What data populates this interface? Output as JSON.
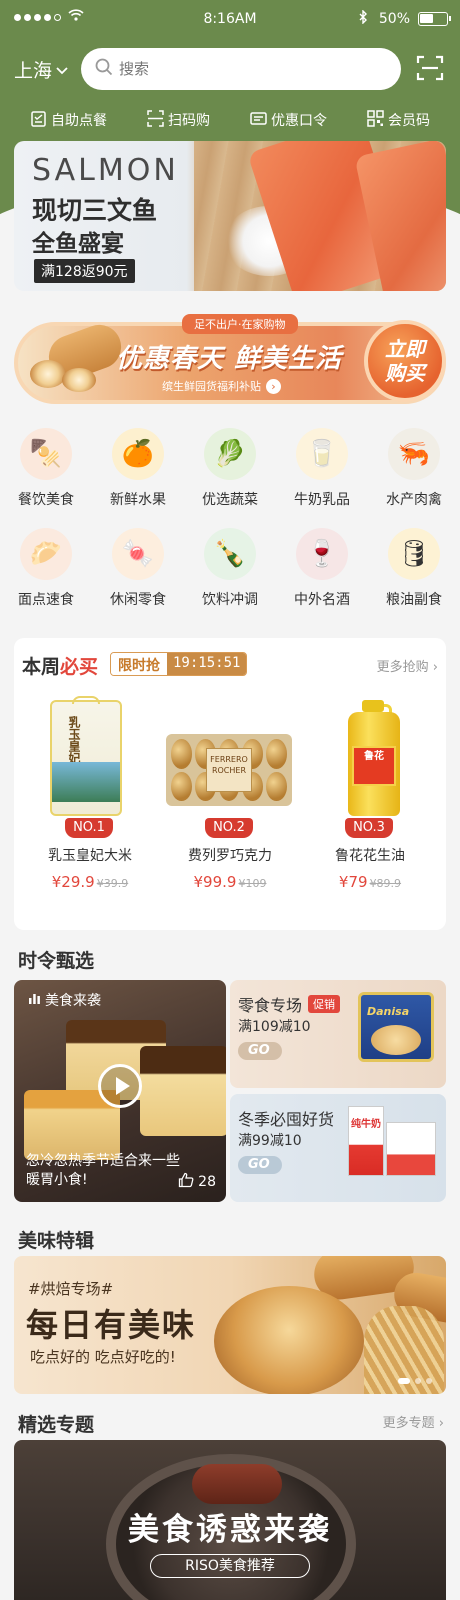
{
  "status_bar": {
    "time": "8:16AM",
    "battery": "50%",
    "battery_level": 0.5
  },
  "header": {
    "city": "上海",
    "search_placeholder": "搜索",
    "quick_nav": [
      {
        "label": "自助点餐",
        "icon": "clipboard-icon"
      },
      {
        "label": "扫码购",
        "icon": "barcode-scan-icon"
      },
      {
        "label": "优惠口令",
        "icon": "coupon-icon"
      },
      {
        "label": "会员码",
        "icon": "qr-code-icon"
      }
    ]
  },
  "banner": {
    "title_en": "SALMON",
    "title_cn": "现切三文鱼",
    "subtitle": "全鱼盛宴",
    "tag": "满128返90元"
  },
  "promo": {
    "ribbon": "足不出户·在家购物",
    "title": "优惠春天 鲜美生活",
    "subtitle": "缤生鲜园货福利补贴",
    "buy_line1": "立即",
    "buy_line2": "购买"
  },
  "categories": [
    {
      "label": "餐饮美食",
      "icon": "food-icon",
      "color": "#fbe8dc",
      "glyph": "🍢"
    },
    {
      "label": "新鲜水果",
      "icon": "fruit-icon",
      "color": "#fdf0cf",
      "glyph": "🍊"
    },
    {
      "label": "优选蔬菜",
      "icon": "vegetable-icon",
      "color": "#e6f2dd",
      "glyph": "🥬"
    },
    {
      "label": "牛奶乳品",
      "icon": "milk-icon",
      "color": "#fdf3dc",
      "glyph": "🥛"
    },
    {
      "label": "水产肉禽",
      "icon": "seafood-icon",
      "color": "#f1eee6",
      "glyph": "🦐"
    },
    {
      "label": "面点速食",
      "icon": "bun-icon",
      "color": "#fbeadf",
      "glyph": "🥟"
    },
    {
      "label": "休闲零食",
      "icon": "snack-icon",
      "color": "#fdeede",
      "glyph": "🍬"
    },
    {
      "label": "饮料冲调",
      "icon": "drink-icon",
      "color": "#e6f3e6",
      "glyph": "🍾"
    },
    {
      "label": "中外名酒",
      "icon": "wine-icon",
      "color": "#f6e6e6",
      "glyph": "🍷"
    },
    {
      "label": "粮油副食",
      "icon": "oil-icon",
      "color": "#fdf2d4",
      "glyph": "🛢"
    }
  ],
  "must_buy": {
    "title_part1": "本周",
    "title_part2": "必买",
    "flash_label": "限时抢",
    "countdown": "19:15:51",
    "more": "更多抢购",
    "products": [
      {
        "rank": "NO.1",
        "name": "乳玉皇妃大米",
        "price": "¥29.9",
        "old_price": "¥39.9",
        "bag_text": "乳玉皇妃"
      },
      {
        "rank": "NO.2",
        "name": "费列罗巧克力",
        "price": "¥99.9",
        "old_price": "¥109",
        "box_text": "FERRERO ROCHER"
      },
      {
        "rank": "NO.3",
        "name": "鲁花花生油",
        "price": "¥79",
        "old_price": "¥89.9",
        "bottle_text": "鲁花"
      }
    ]
  },
  "seasonal": {
    "title": "时令甄选",
    "video": {
      "tag": "美食来袭",
      "caption": "忽冷忽热季节适合来一些暖胃小食!",
      "likes": "28"
    },
    "cards": [
      {
        "title": "零食专场",
        "badge": "促销",
        "subtitle": "满109减10",
        "go": "GO",
        "product_text": "Danisa"
      },
      {
        "title": "冬季必囤好货",
        "subtitle": "满99减10",
        "go": "GO",
        "product_text": "纯牛奶"
      }
    ]
  },
  "feature": {
    "title": "美味特辑",
    "hashtag": "#烘焙专场#",
    "headline": "每日有美味",
    "slogan": "吃点好的 吃点好吃的!",
    "slide_count": 3,
    "active_slide": 1
  },
  "topics": {
    "title": "精选专题",
    "more": "更多专题",
    "banner_title": "美食诱惑来袭",
    "banner_subtitle": "RISO美食推荐"
  }
}
